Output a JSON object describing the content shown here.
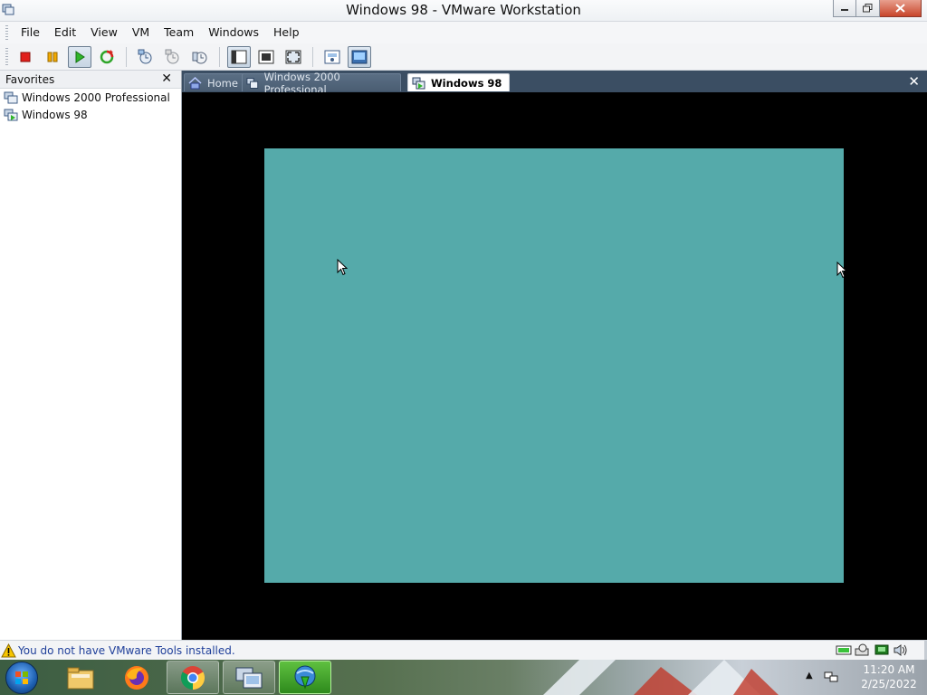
{
  "window": {
    "title": "Windows 98 - VMware Workstation"
  },
  "menu": {
    "items": [
      "File",
      "Edit",
      "View",
      "VM",
      "Team",
      "Windows",
      "Help"
    ]
  },
  "toolbar": {
    "buttons": [
      {
        "icon": "stop-icon",
        "pressed": false
      },
      {
        "icon": "pause-icon",
        "pressed": false
      },
      {
        "icon": "play-icon",
        "pressed": true
      },
      {
        "icon": "reset-icon",
        "pressed": false
      },
      {
        "icon": "snapshot-take-icon",
        "pressed": false
      },
      {
        "icon": "snapshot-revert-icon",
        "pressed": false
      },
      {
        "icon": "snapshot-manager-icon",
        "pressed": false
      },
      {
        "icon": "show-sidebar-icon",
        "pressed": true
      },
      {
        "icon": "quick-switch-icon",
        "pressed": false
      },
      {
        "icon": "full-screen-icon",
        "pressed": false
      },
      {
        "icon": "summary-view-icon",
        "pressed": false
      },
      {
        "icon": "console-view-icon",
        "pressed": true
      }
    ]
  },
  "sidebar": {
    "title": "Favorites",
    "items": [
      {
        "label": "Windows 2000 Professional",
        "icon": "vm-icon"
      },
      {
        "label": "Windows 98",
        "icon": "vm-running-icon"
      }
    ]
  },
  "tabs": {
    "items": [
      {
        "label": "Home",
        "icon": "home-icon",
        "active": false
      },
      {
        "label": "Windows 2000 Professional",
        "icon": "vm-icon",
        "active": false
      },
      {
        "label": "Windows 98",
        "icon": "vm-running-icon",
        "active": true
      }
    ]
  },
  "vm": {
    "screen_color": "#55aaaa",
    "background": "#000000"
  },
  "status": {
    "message": "You do not have VMware Tools installed."
  },
  "taskbar": {
    "apps": [
      {
        "name": "explorer",
        "icon": "folder-icon"
      },
      {
        "name": "firefox",
        "icon": "firefox-icon"
      },
      {
        "name": "chrome",
        "icon": "chrome-icon"
      },
      {
        "name": "vmware-workstation",
        "icon": "vmware-icon"
      },
      {
        "name": "internet-download-manager",
        "icon": "idm-icon"
      }
    ],
    "clock": {
      "time": "11:20 AM",
      "date": "2/25/2022"
    }
  },
  "colors": {
    "tab_strip": "#3b4e63",
    "status_text": "#1f3f9a",
    "taskbar_active": "#3c9a26"
  }
}
